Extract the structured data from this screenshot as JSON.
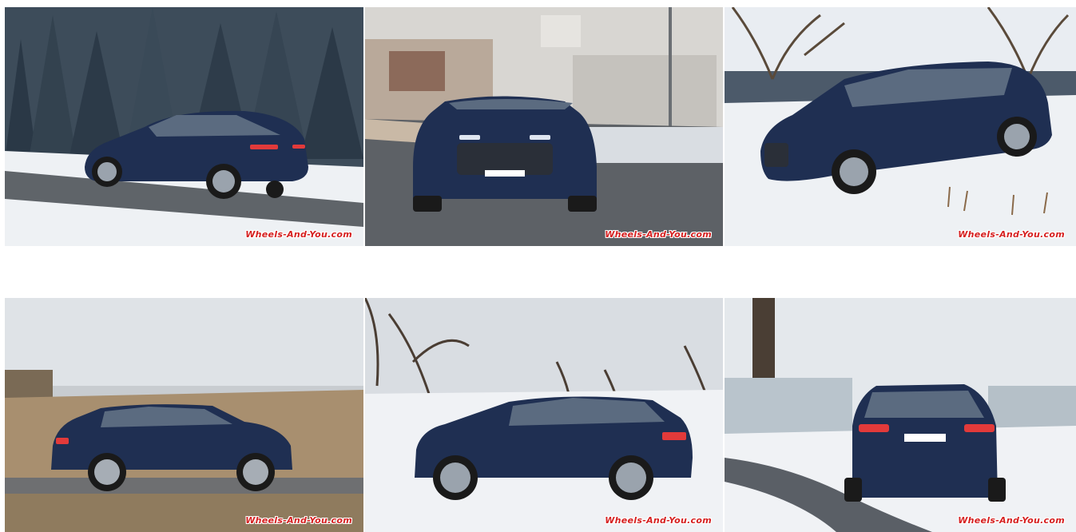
{
  "gallery": {
    "photos": [
      {
        "watermark": "Wheels-And-You.com"
      },
      {
        "watermark": "Wheels-And-You.com"
      },
      {
        "watermark": "Wheels-And-You.com"
      },
      {
        "watermark": "Wheels-And-You.com"
      },
      {
        "watermark": "Wheels-And-You.com"
      },
      {
        "watermark": "Wheels-And-You.com"
      }
    ]
  },
  "colors": {
    "page_background": "#ffffff",
    "car_body": "#1f2f52",
    "watermark": "#d62020",
    "snow": "#eef1f4"
  }
}
